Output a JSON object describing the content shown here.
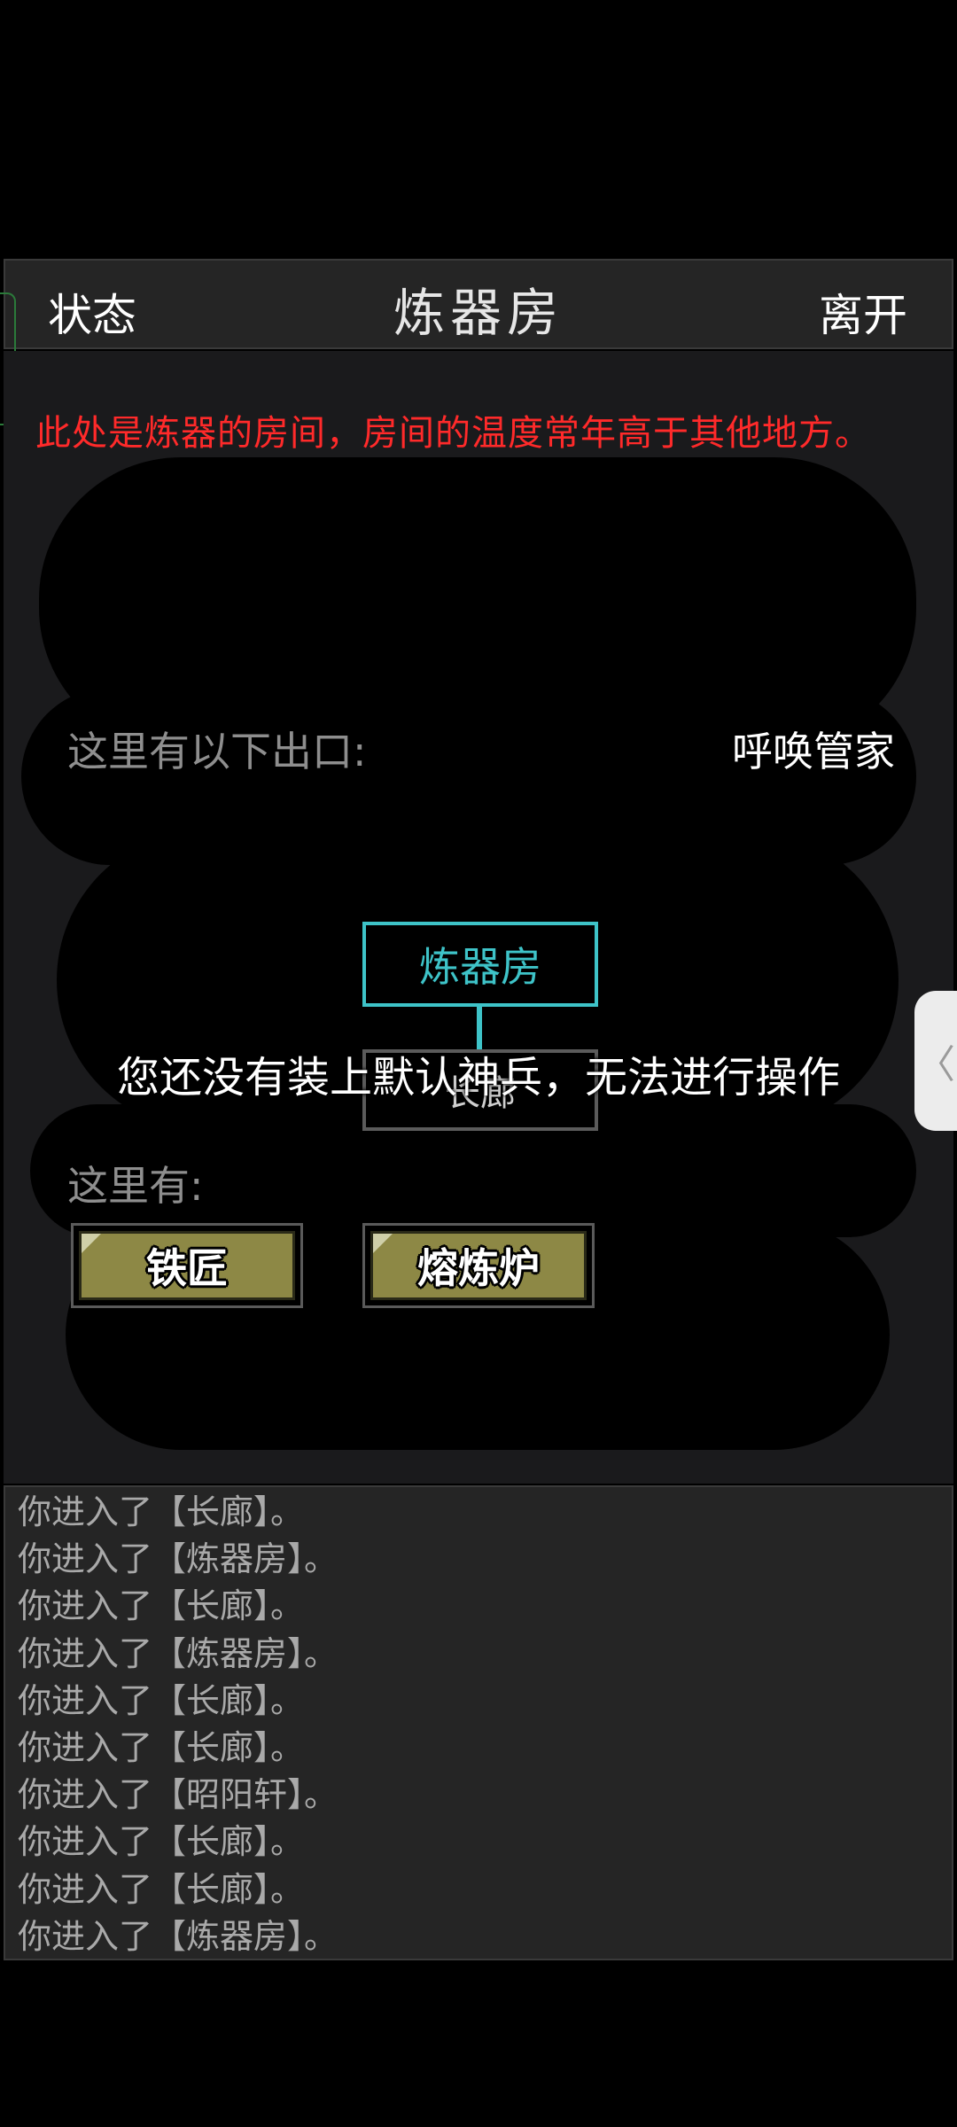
{
  "header": {
    "status_label": "状态",
    "title": "炼器房",
    "leave_label": "离开"
  },
  "scene": {
    "description": "此处是炼器的房间，房间的温度常年高于其他地方。",
    "exits_label": "这里有以下出口:",
    "summon_label": "呼唤管家",
    "map": {
      "current_room": "炼器房",
      "connected_room": "长廊"
    },
    "toast": "您还没有装上默认神兵，无法进行操作",
    "here_label": "这里有:",
    "npcs": [
      {
        "label": "铁匠"
      },
      {
        "label": "熔炼炉"
      }
    ],
    "side_handle_icon": "chevron-left-icon"
  },
  "log": [
    "你进入了【长廊】。",
    "你进入了【炼器房】。",
    "你进入了【长廊】。",
    "你进入了【炼器房】。",
    "你进入了【长廊】。",
    "你进入了【长廊】。",
    "你进入了【昭阳轩】。",
    "你进入了【长廊】。",
    "你进入了【长廊】。",
    "你进入了【炼器房】。"
  ],
  "colors": {
    "description": "#ff2a2a",
    "current_room": "#3ec3c8",
    "npc_button": "#8d8845"
  }
}
